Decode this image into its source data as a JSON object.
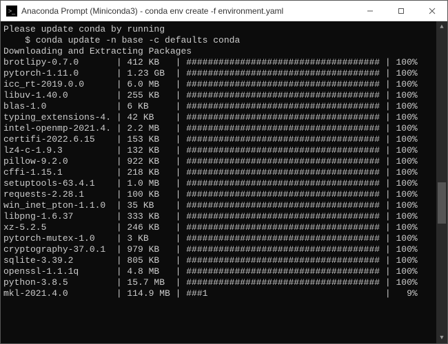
{
  "window": {
    "title": "Anaconda Prompt (Miniconda3) - conda  env create -f environment.yaml"
  },
  "header": {
    "update_msg": "Please update conda by running",
    "update_cmd": "    $ conda update -n base -c defaults conda",
    "section": "Downloading and Extracting Packages"
  },
  "bar_full": "####################################",
  "packages": [
    {
      "name": "brotlipy-0.7.0",
      "size": "412 KB",
      "pct": 100
    },
    {
      "name": "pytorch-1.11.0",
      "size": "1.23 GB",
      "pct": 100
    },
    {
      "name": "icc_rt-2019.0.0",
      "size": "6.0 MB",
      "pct": 100
    },
    {
      "name": "libuv-1.40.0",
      "size": "255 KB",
      "pct": 100
    },
    {
      "name": "blas-1.0",
      "size": "6 KB",
      "pct": 100
    },
    {
      "name": "typing_extensions-4.",
      "size": "42 KB",
      "pct": 100
    },
    {
      "name": "intel-openmp-2021.4.",
      "size": "2.2 MB",
      "pct": 100
    },
    {
      "name": "certifi-2022.6.15",
      "size": "153 KB",
      "pct": 100
    },
    {
      "name": "lz4-c-1.9.3",
      "size": "132 KB",
      "pct": 100
    },
    {
      "name": "pillow-9.2.0",
      "size": "922 KB",
      "pct": 100
    },
    {
      "name": "cffi-1.15.1",
      "size": "218 KB",
      "pct": 100
    },
    {
      "name": "setuptools-63.4.1",
      "size": "1.0 MB",
      "pct": 100
    },
    {
      "name": "requests-2.28.1",
      "size": "100 KB",
      "pct": 100
    },
    {
      "name": "win_inet_pton-1.1.0",
      "size": "35 KB",
      "pct": 100
    },
    {
      "name": "libpng-1.6.37",
      "size": "333 KB",
      "pct": 100
    },
    {
      "name": "xz-5.2.5",
      "size": "246 KB",
      "pct": 100
    },
    {
      "name": "pytorch-mutex-1.0",
      "size": "3 KB",
      "pct": 100
    },
    {
      "name": "cryptography-37.0.1",
      "size": "979 KB",
      "pct": 100
    },
    {
      "name": "sqlite-3.39.2",
      "size": "805 KB",
      "pct": 100
    },
    {
      "name": "openssl-1.1.1q",
      "size": "4.8 MB",
      "pct": 100
    },
    {
      "name": "python-3.8.5",
      "size": "15.7 MB",
      "pct": 100
    },
    {
      "name": "mkl-2021.4.0",
      "size": "114.9 MB",
      "pct": 9
    }
  ]
}
